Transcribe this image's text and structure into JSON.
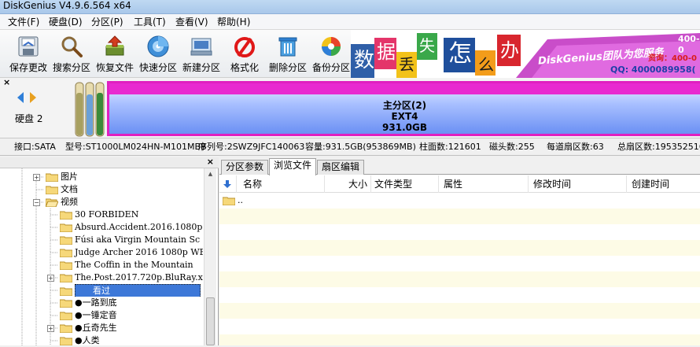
{
  "window": {
    "title": "DiskGenius V4.9.6.564 x64"
  },
  "menu": [
    {
      "label": "文件(F)"
    },
    {
      "label": "硬盘(D)"
    },
    {
      "label": "分区(P)"
    },
    {
      "label": "工具(T)"
    },
    {
      "label": "查看(V)"
    },
    {
      "label": "帮助(H)"
    }
  ],
  "toolbar": {
    "save": "保存更改",
    "search": "搜索分区",
    "recover": "恢复文件",
    "quick_partition": "快速分区",
    "new_partition": "新建分区",
    "format": "格式化",
    "delete": "删除分区",
    "backup": "备份分区"
  },
  "banner": {
    "chars": [
      "数",
      "据",
      "丢",
      "失",
      "怎",
      "么",
      "办"
    ],
    "team_text": "DiskGenius团队为您服务",
    "phone_text": "资询：400-0",
    "qq_text": "QQ: 4000089958(",
    "top_text": "400-0"
  },
  "disk": {
    "label": "硬盘 2",
    "partition_name": "主分区(2)",
    "fs": "EXT4",
    "size": "931.0GB"
  },
  "disk_info": {
    "interface": "接口:SATA",
    "model": "型号:ST1000LM024HN-M101MBB",
    "serial": "序列号:2SWZ9JFC140063",
    "capacity": "容量:931.5GB(953869MB)",
    "cylinders": "柱面数:121601",
    "heads": "磁头数:255",
    "sectors_per_track": "每道扇区数:63",
    "total_sectors": "总扇区数:195352516"
  },
  "tree": {
    "items": [
      {
        "label": "图片"
      },
      {
        "label": "文档"
      },
      {
        "label": "视频"
      },
      {
        "label": "30 FORBIDEN"
      },
      {
        "label": "Absurd.Accident.2016.1080p."
      },
      {
        "label": "Fúsi aka Virgin Mountain Sc"
      },
      {
        "label": "Judge Archer 2016 1080p WEB"
      },
      {
        "label": "The Coffin in the Mountain"
      },
      {
        "label": "The.Post.2017.720p.BluRay.x"
      },
      {
        "label": "看过"
      },
      {
        "label": "●一路到底"
      },
      {
        "label": "●一锤定音"
      },
      {
        "label": "●丘奇先生"
      },
      {
        "label": "●人类"
      }
    ]
  },
  "tabs": [
    {
      "label": "分区参数"
    },
    {
      "label": "浏览文件"
    },
    {
      "label": "扇区编辑"
    }
  ],
  "columns": {
    "name": "名称",
    "size": "大小",
    "type": "文件类型",
    "attr": "属性",
    "modified": "修改时间",
    "created": "创建时间"
  },
  "files": [
    {
      "name": ".."
    }
  ],
  "colors": {
    "partition_gradient_top": "#b9c9ff",
    "partition_gradient_bottom": "#4d7af0",
    "partition_border": "#e020c0",
    "selection": "#3d78d8"
  }
}
